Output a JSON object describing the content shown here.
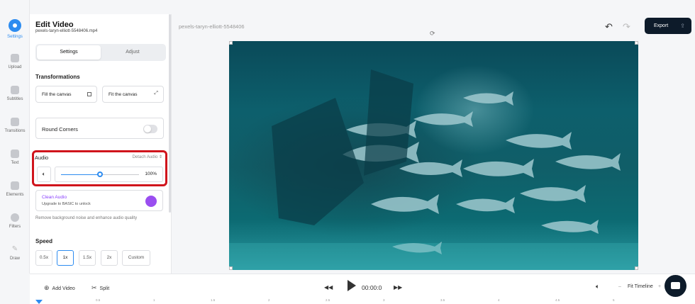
{
  "rail": {
    "items": [
      {
        "label": "Settings",
        "icon": "settings-icon",
        "active": true
      },
      {
        "label": "Upload",
        "icon": "upload-icon"
      },
      {
        "label": "Subtitles",
        "icon": "subtitles-icon"
      },
      {
        "label": "Transitions",
        "icon": "transitions-icon"
      },
      {
        "label": "Text",
        "icon": "text-icon"
      },
      {
        "label": "Elements",
        "icon": "elements-icon"
      },
      {
        "label": "Filters",
        "icon": "filters-icon"
      },
      {
        "label": "Draw",
        "icon": "draw-icon"
      }
    ]
  },
  "panel": {
    "title": "Edit Video",
    "filename": "pexels-taryn-elliott-5548406.mp4",
    "tabs": {
      "settings": "Settings",
      "adjust": "Adjust"
    },
    "transformations": {
      "title": "Transformations",
      "fill": "Fill the canvas",
      "fit": "Fit the canvas"
    },
    "round_corners": "Round Corners",
    "audio": {
      "title": "Audio",
      "detach": "Detach Audio",
      "volume_value": "100%",
      "volume_fraction": 0.5
    },
    "clean_audio": {
      "title": "Clean Audio",
      "subtitle": "Upgrade to BASIC to unlock",
      "note": "Remove background noise and enhance audio quality"
    },
    "speed": {
      "title": "Speed",
      "options": [
        "0.5x",
        "1x",
        "1.5x",
        "2x",
        "Custom"
      ],
      "selected": "1x"
    }
  },
  "canvas": {
    "project_name": "pexels-taryn-elliott-5548406",
    "export_label": "Export"
  },
  "bottom": {
    "add_video": "Add Video",
    "split": "Split",
    "time": "00:00:0",
    "fit_timeline": "Fit Timeline",
    "ruler": [
      "0.5",
      "1",
      "1.5",
      "2",
      "2.5",
      "3",
      "3.5",
      "4",
      "4.5",
      "5"
    ]
  },
  "colors": {
    "accent": "#2d8cf0",
    "highlight": "#d0141c",
    "export_bg": "#0d1b2a",
    "premium": "#8a3ffc"
  }
}
